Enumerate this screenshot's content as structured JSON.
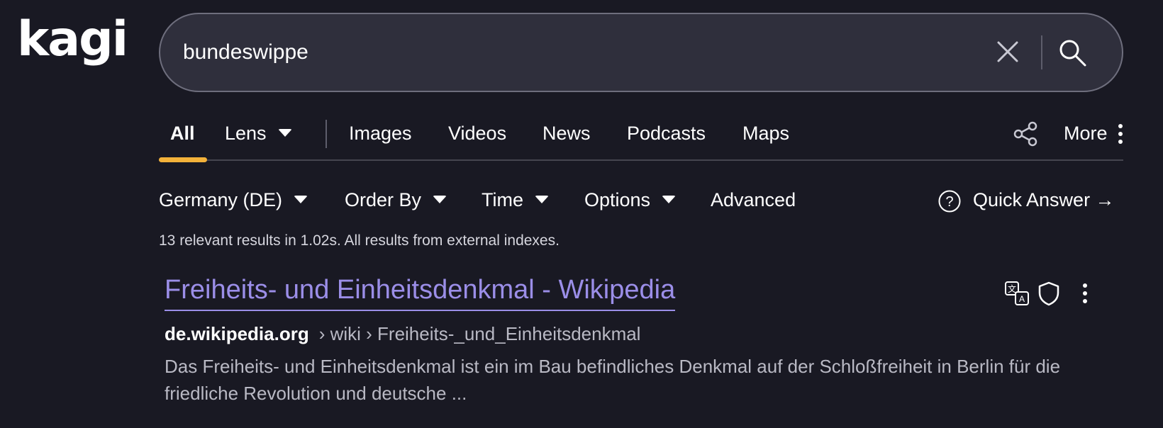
{
  "brand": {
    "logo_text": "kagi"
  },
  "search": {
    "query": "bundeswippe"
  },
  "tabs": {
    "items": [
      "All",
      "Lens",
      "Images",
      "Videos",
      "News",
      "Podcasts",
      "Maps"
    ],
    "more": "More",
    "active": "All"
  },
  "filters": {
    "region": "Germany (DE)",
    "order_by": "Order By",
    "time": "Time",
    "options": "Options",
    "advanced": "Advanced",
    "quick_answer": "Quick Answer →"
  },
  "meta": {
    "summary": "13 relevant results in 1.02s. All results from external indexes."
  },
  "results": [
    {
      "title": "Freiheits- und Einheitsdenkmal - Wikipedia",
      "domain": "de.wikipedia.org",
      "path": "› wiki › Freiheits-_und_Einheitsdenkmal",
      "snippet": "Das Freiheits- und Einheitsdenkmal ist ein im Bau befindliches Denkmal auf der Schloßfreiheit in Berlin für die friedliche Revolution und deutsche ..."
    }
  ],
  "colors": {
    "background": "#191923",
    "accent": "#f3b23a",
    "link": "#9b8ee8",
    "search_bg": "#2f2f3c"
  },
  "icons": {
    "clear": "close-icon",
    "search": "search-icon",
    "share": "share-icon",
    "more": "vertical-dots-icon",
    "help": "question-circle-icon",
    "translate": "translate-icon",
    "shield": "shield-icon"
  }
}
